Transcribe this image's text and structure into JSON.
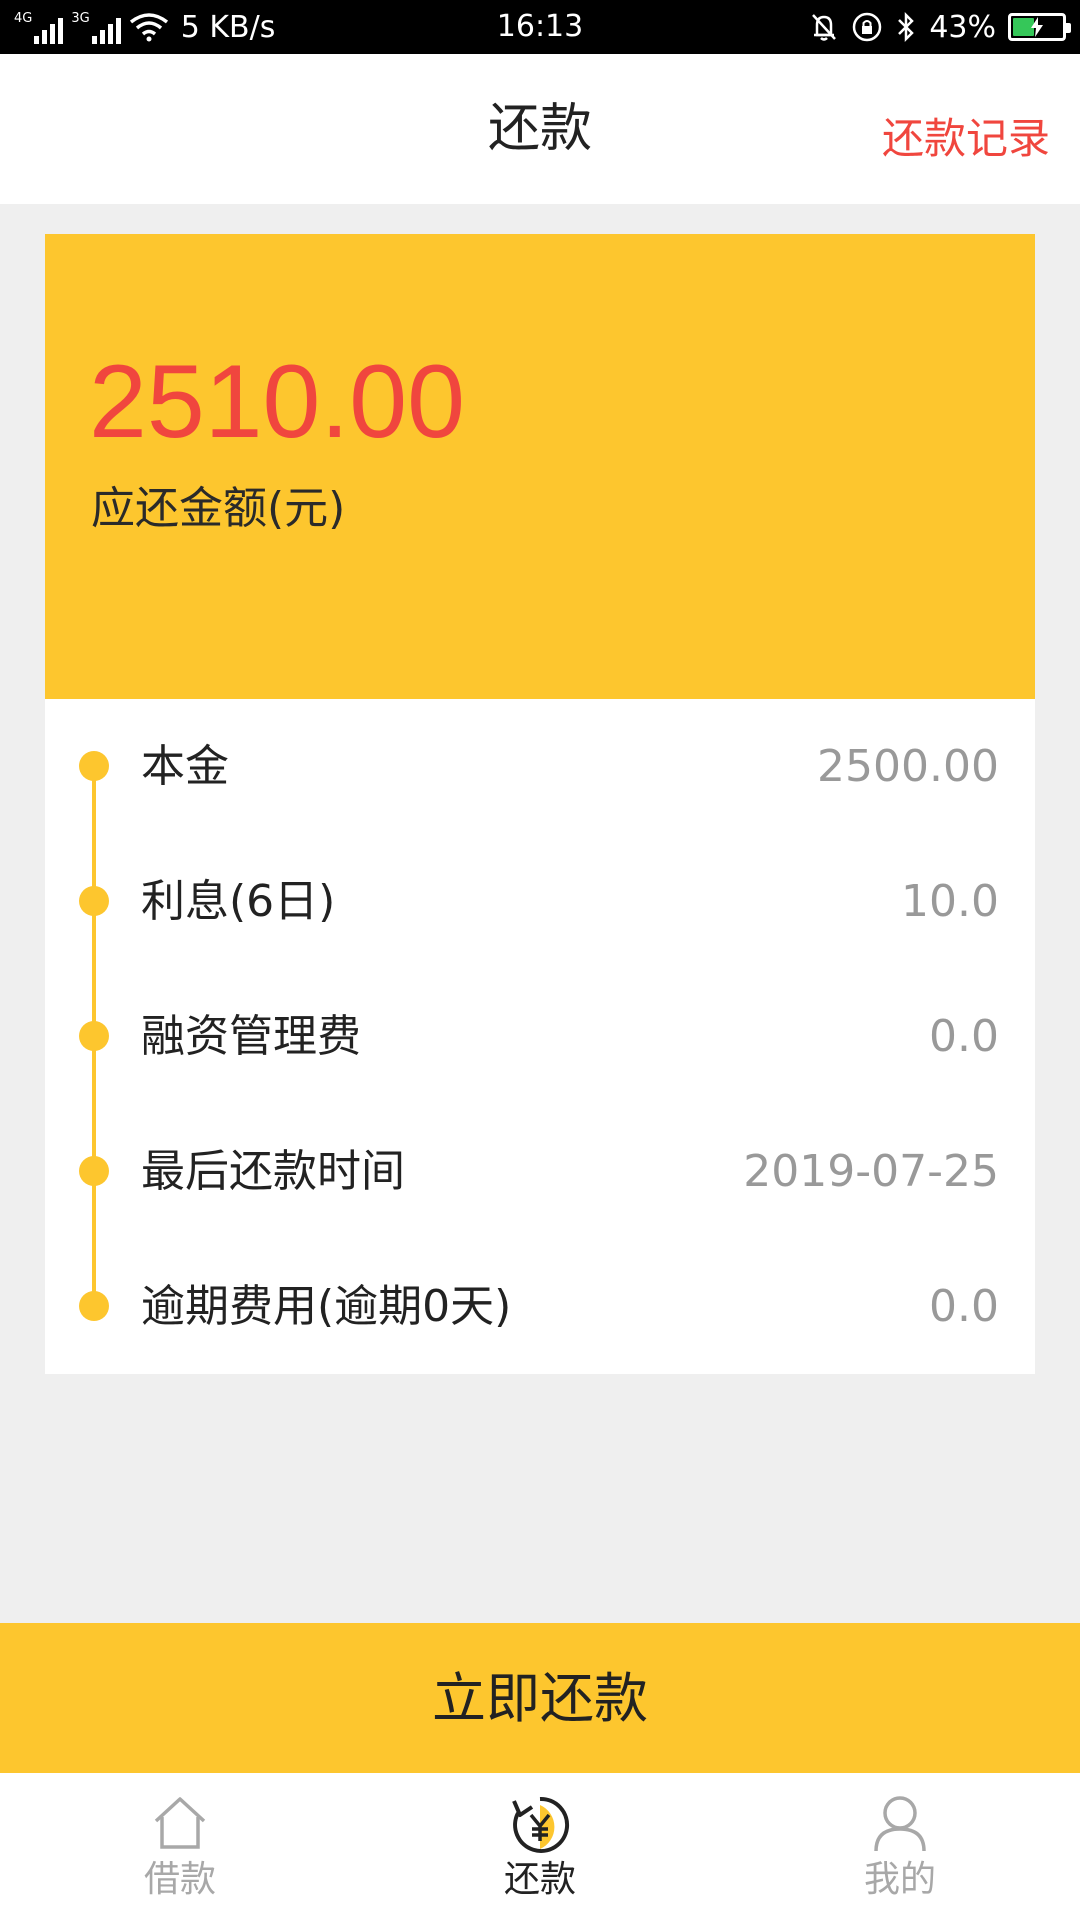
{
  "status_bar": {
    "network_primary": "4G",
    "network_secondary": "3G",
    "speed": "5 KB/s",
    "time": "16:13",
    "battery": "43%",
    "battery_level": 0.43,
    "battery_color": "#35c759",
    "icons": [
      "mute-icon",
      "rotation-lock-icon",
      "bluetooth-icon",
      "battery-charging-icon",
      "wifi-icon",
      "signal-icon"
    ]
  },
  "header": {
    "title": "还款",
    "records_link": "还款记录"
  },
  "amount_card": {
    "value": "2510.00",
    "label": "应还金额(元)"
  },
  "details": [
    {
      "label": "本金",
      "value": "2500.00"
    },
    {
      "label": "利息(6日)",
      "value": "10.0"
    },
    {
      "label": "融资管理费",
      "value": "0.0"
    },
    {
      "label": "最后还款时间",
      "value": "2019-07-25"
    },
    {
      "label": "逾期费用(逾期0天)",
      "value": "0.0"
    }
  ],
  "pay_button": {
    "label": "立即还款"
  },
  "tabs": [
    {
      "label": "借款",
      "icon": "home-icon",
      "active": false
    },
    {
      "label": "还款",
      "icon": "repay-yuan-icon",
      "active": true
    },
    {
      "label": "我的",
      "icon": "user-icon",
      "active": false
    }
  ],
  "colors": {
    "accent": "#fdc62e",
    "highlight_red": "#f0463e",
    "tab_active": "#222222",
    "tab_inactive": "#a8a8a8",
    "background": "#efefef"
  }
}
